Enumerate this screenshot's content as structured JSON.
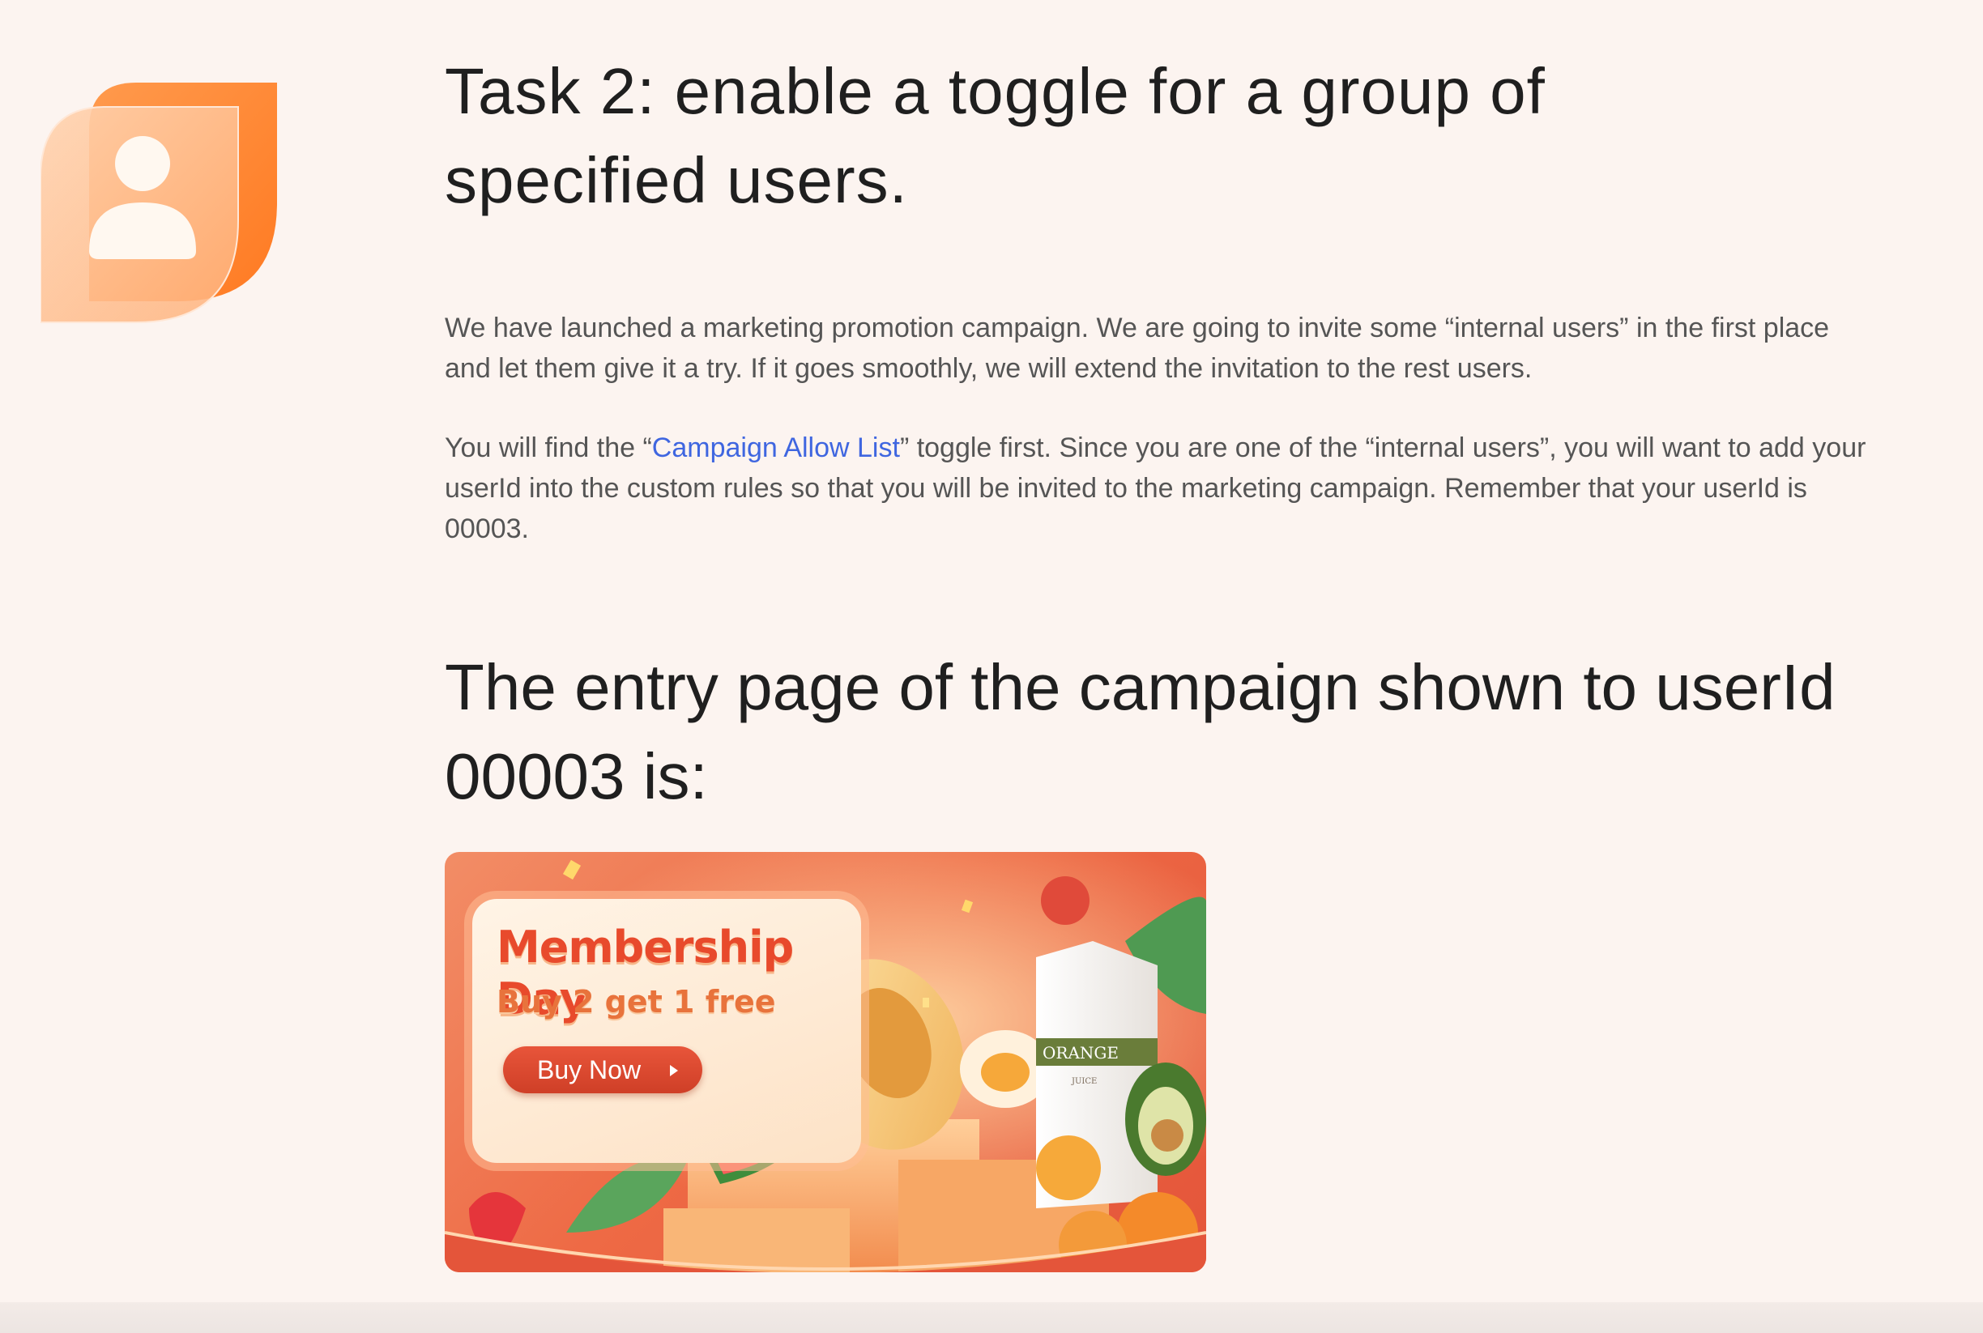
{
  "task": {
    "title": "Task 2: enable a toggle for a group of specified users."
  },
  "intro": {
    "paragraph_1": "We have launched a marketing promotion campaign. We are going to invite some “internal users” in the first place and let them give it a try. If it goes smoothly, we will extend the invitation to the rest users.",
    "paragraph_2_before": "You will find the “",
    "paragraph_2_link": "Campaign Allow List",
    "paragraph_2_after": "” toggle first. Since you are one of the “internal users”, you will want to add your userId into the custom rules so that you will be invited to the marketing campaign. Remember that your userId is 00003."
  },
  "entry": {
    "title": "The entry page of the campaign shown to userId 00003 is:"
  },
  "banner": {
    "title": "Membership Day",
    "subtitle": "Buy 2 get 1 free",
    "button_label": "Buy Now",
    "juice_brand": "ORANGE",
    "juice_sub": "JUICE"
  },
  "colors": {
    "page_background": "#fcf4f0",
    "link": "#3f66e0",
    "icon_orange": "#ff8a3d",
    "banner_red": "#e4553a"
  },
  "icons": {
    "user": "user-icon",
    "button_arrow": "caret-right-icon"
  }
}
